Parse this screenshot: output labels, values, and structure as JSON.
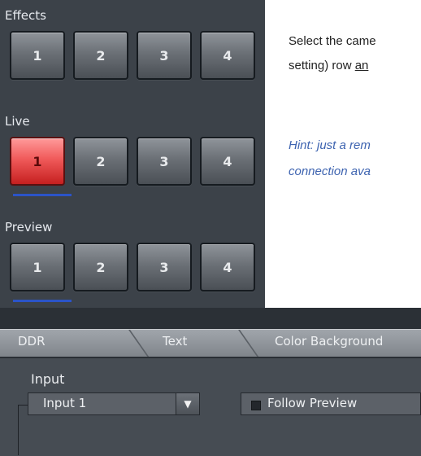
{
  "switcher": {
    "effects": {
      "label": "Effects",
      "buttons": [
        "1",
        "2",
        "3",
        "4"
      ]
    },
    "live": {
      "label": "Live",
      "buttons": [
        "1",
        "2",
        "3",
        "4"
      ],
      "active": "1"
    },
    "preview": {
      "label": "Preview",
      "buttons": [
        "1",
        "2",
        "3",
        "4"
      ],
      "active": "1"
    }
  },
  "instructions": {
    "line1": "Select the came",
    "line2_a": "setting) row ",
    "line2_b": "an",
    "hint1": "Hint: just a rem",
    "hint2": "connection ava"
  },
  "tabs": [
    "DDR",
    "Text",
    "Color Background"
  ],
  "panel": {
    "input_label": "Input",
    "input_value": "Input 1",
    "follow_label": "Follow Preview"
  },
  "colors": {
    "accent_live": "#e84a4a",
    "underline": "#2b54c8",
    "hint": "#3d63b0"
  }
}
